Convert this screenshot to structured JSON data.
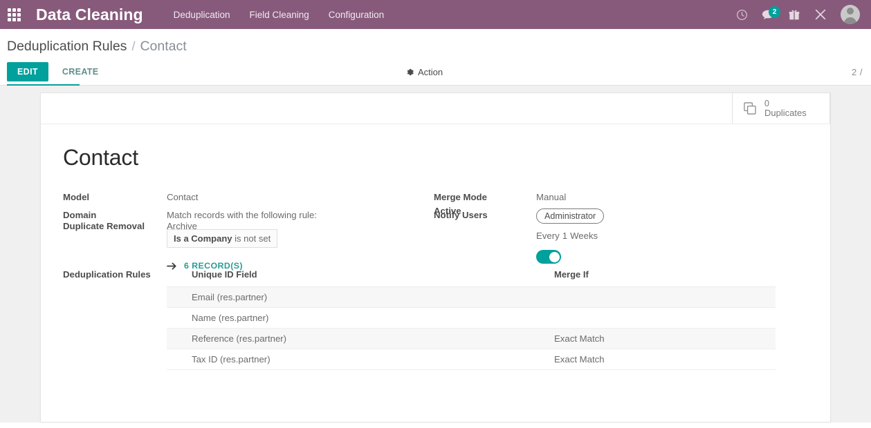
{
  "navbar": {
    "apps_icon": "apps-grid-icon",
    "brand": "Data Cleaning",
    "menu": [
      {
        "label": "Deduplication"
      },
      {
        "label": "Field Cleaning"
      },
      {
        "label": "Configuration"
      }
    ],
    "icons": [
      {
        "name": "clock-icon"
      },
      {
        "name": "chat-icon",
        "badge": "2"
      },
      {
        "name": "gift-icon"
      },
      {
        "name": "tools-icon"
      }
    ],
    "avatar": "user-avatar",
    "accent_color": "#875A7B"
  },
  "control_panel": {
    "breadcrumb_root": "Deduplication Rules",
    "breadcrumb_separator": "/",
    "breadcrumb_current": "Contact",
    "edit_label": "EDIT",
    "create_label": "CREATE",
    "action_label": "Action",
    "action_icon": "gear-icon",
    "pager": "2 /",
    "accent_color": "#00A09D"
  },
  "stat_buttons": [
    {
      "icon": "duplicate-copy-icon",
      "value": "0",
      "label": "Duplicates"
    }
  ],
  "record": {
    "title": "Contact",
    "fields": {
      "model_label": "Model",
      "model_value": "Contact",
      "domain_label": "Domain",
      "domain_value": "Match records with the following rule:",
      "domain_chip_field": "Is a Company",
      "domain_chip_operator": "is not set",
      "records_link_label": "6 RECORD(S)",
      "records_link_icon": "arrow-right-icon",
      "duplicate_removal_label": "Duplicate Removal",
      "duplicate_removal_value": "Archive",
      "merge_mode_label": "Merge Mode",
      "merge_mode_value": "Manual",
      "notify_users_label": "Notify Users",
      "notify_users_tag": "Administrator",
      "interval_prefix": "Every",
      "interval_number": "1",
      "interval_unit": "Weeks",
      "active_label": "Active",
      "active_state": "on"
    }
  },
  "rules_table": {
    "section_label": "Deduplication Rules",
    "columns": [
      "Unique ID Field",
      "Merge If"
    ],
    "rows": [
      {
        "field": "Email (res.partner)",
        "merge_if": ""
      },
      {
        "field": "Name (res.partner)",
        "merge_if": ""
      },
      {
        "field": "Reference (res.partner)",
        "merge_if": "Exact Match"
      },
      {
        "field": "Tax ID (res.partner)",
        "merge_if": "Exact Match"
      }
    ]
  }
}
